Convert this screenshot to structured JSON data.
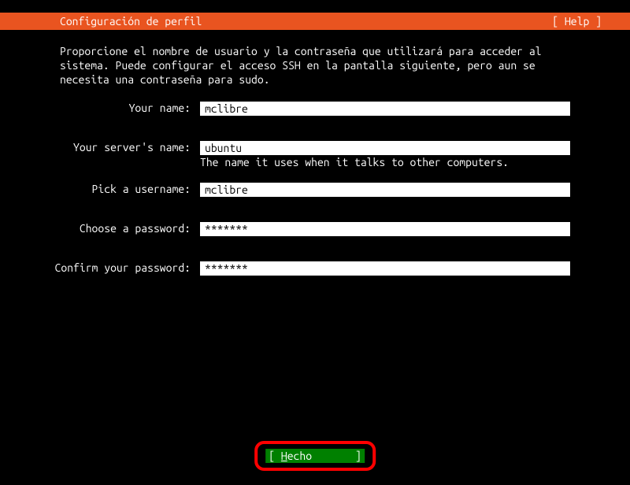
{
  "header": {
    "title": "Configuración de perfil",
    "help": "[ Help ]"
  },
  "description": "Proporcione el nombre de usuario y la contraseña que utilizará para acceder al sistema. Puede configurar el acceso SSH en la pantalla siguiente, pero aun se necesita una contraseña para sudo.",
  "form": {
    "name_label": "Your name:",
    "name_value": "mclibre",
    "server_label": "Your server's name:",
    "server_value": "ubuntu",
    "server_hint": "The name it uses when it talks to other computers.",
    "username_label": "Pick a username:",
    "username_value": "mclibre",
    "password_label": "Choose a password:",
    "password_value": "*******",
    "confirm_label": "Confirm your password:",
    "confirm_value": "*******"
  },
  "footer": {
    "done_prefix": "[ ",
    "done_hotkey": "H",
    "done_rest": "echo       ]"
  }
}
